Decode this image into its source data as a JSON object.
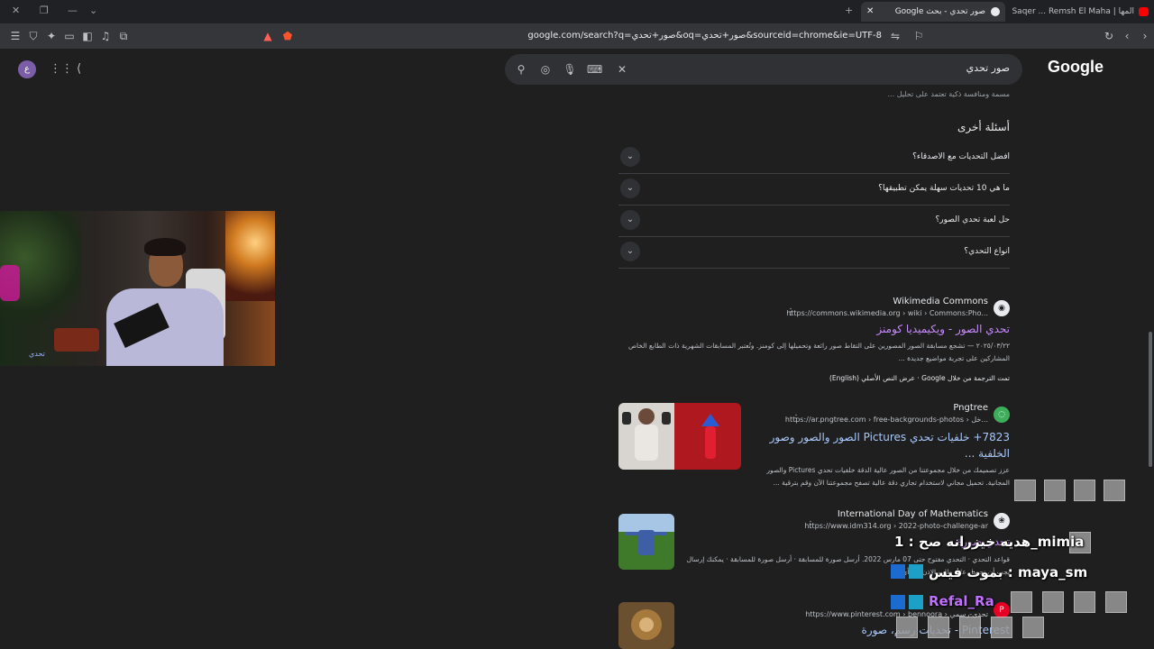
{
  "browser": {
    "tabs": [
      {
        "title": "Google صور تحدي - بحث",
        "active": true
      },
      {
        "title": "Rabeh Saqer ... Remsh El Maha | المها",
        "active": false
      }
    ],
    "url": "google.com/search?q=صور+تحدي&oq=صور+تحدي&sourceid=chrome&ie=UTF-8"
  },
  "header": {
    "logo": "Google",
    "search_query": "صور تحدي",
    "avatar_letter": "ع"
  },
  "top_snippet": "مسمة ومنافسة ذكية تعتمد على تحليل ...",
  "paa": {
    "title": "أسئلة أخرى",
    "questions": [
      "افضل التحديات مع الاصدقاء؟",
      "ما هي 10 تحديات سهلة يمكن تطبيقها؟",
      "حل لعبة تحدي الصور؟",
      "انواع التحدي؟"
    ]
  },
  "results": [
    {
      "site": "Wikimedia Commons",
      "crumb": "https://commons.wikimedia.org › wiki › Commons:Pho...",
      "title": "تحدي الصور - ويكيميديا كومنز",
      "snippet1": "٢٠٢٥/٠٣/٢٢ — تشجع مسابقة الصور المصورين على التقاط صور رائعة وتحميلها إلى كومنز. وتُعتبر المسابقات الشهرية ذات الطابع الخاص",
      "snippet2": "المشاركين على تجربة مواضيع جديدة ...",
      "translate_note": "تمت الترجمة من خلال Google · عرض النص الأصلي (English)"
    },
    {
      "site": "Pngtree",
      "crumb": "https://ar.pngtree.com › free-backgrounds-photos › خل...",
      "title": "7823+ خلفيات تحدي Pictures الصور والصور وصور الخلفية ...",
      "snippet1": "عزز تصميمك من خلال مجموعتنا من الصور عالية الدقة خلفيات تحدي Pictures والصور",
      "snippet2": "المجانية. تحميل مجاني لاستخدام تجاري دقة عالية تصفح مجموعتنا الآن وقم بترقية ..."
    },
    {
      "site": "International Day of Mathematics",
      "crumb": "https://www.idm314.org › 2022-photo-challenge-ar",
      "title": "تحدي صورة",
      "snippet1": "قواعد التحدي · التحدي مفتوح حتى 07 مارس 2022. أرسل صورة للمسابقة · أرسل صورة للمسابقة · يمكنك إرسال",
      "snippet2": "يجب أن تحصل على طلب الإذن من أي ..."
    },
    {
      "site": "Pinterest",
      "crumb": "https://www.pinterest.com › bennoora › تحدي-رسمي",
      "title": "Pinterest - تحديات رسم، صورة"
    }
  ],
  "overlays": {
    "line1": "هديه خيزرانه صح : 1_mimia",
    "line2": "بموت فيس : maya_sm",
    "line3": "Refal_Ra",
    "webcam_caption": "تحدي"
  },
  "colors": {
    "link": "#a8c7fa",
    "visited": "#c58af9",
    "background": "#1f1f1f"
  }
}
